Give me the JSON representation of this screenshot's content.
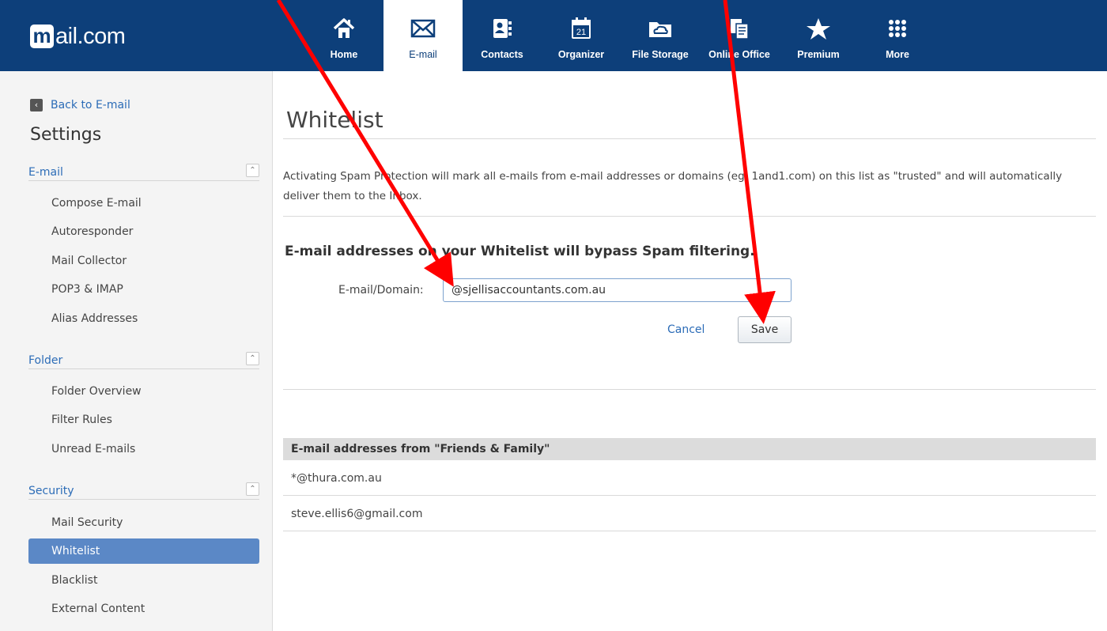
{
  "brand": {
    "logo_letter": "m",
    "logo_text": "ail.com"
  },
  "nav": [
    {
      "label": "Home",
      "icon": "home-icon"
    },
    {
      "label": "E-mail",
      "icon": "envelope-icon",
      "active": true
    },
    {
      "label": "Contacts",
      "icon": "contacts-icon"
    },
    {
      "label": "Organizer",
      "icon": "calendar-icon",
      "day": "21"
    },
    {
      "label": "File Storage",
      "icon": "cloud-folder-icon"
    },
    {
      "label": "Online Office",
      "icon": "documents-icon"
    },
    {
      "label": "Premium",
      "icon": "star-icon"
    },
    {
      "label": "More",
      "icon": "grid-icon"
    }
  ],
  "sidebar": {
    "back_label": "Back to E-mail",
    "title": "Settings",
    "sections": [
      {
        "title": "E-mail",
        "items": [
          "Compose E-mail",
          "Autoresponder",
          "Mail Collector",
          "POP3 & IMAP",
          "Alias Addresses"
        ]
      },
      {
        "title": "Folder",
        "items": [
          "Folder Overview",
          "Filter Rules",
          "Unread E-mails"
        ]
      },
      {
        "title": "Security",
        "items": [
          "Mail Security",
          "Whitelist",
          "Blacklist",
          "External Content"
        ]
      }
    ],
    "active_item": "Whitelist"
  },
  "main": {
    "title": "Whitelist",
    "description": "Activating Spam Protection will mark all e-mails from e-mail addresses or domains (eg: 1and1.com) on this list as \"trusted\" and will automatically deliver them to the Inbox.",
    "subheading": "E-mail addresses on your Whitelist will bypass Spam filtering.",
    "field_label": "E-mail/Domain:",
    "field_value": "@sjellisaccountants.com.au",
    "cancel_label": "Cancel",
    "save_label": "Save",
    "list_header": "E-mail addresses from \"Friends & Family\"",
    "list_items": [
      "*@thura.com.au",
      "steve.ellis6@gmail.com"
    ]
  },
  "colors": {
    "topbar": "#0d3f7a",
    "link": "#2c6cb7",
    "active_item": "#5b88c6",
    "annotation": "#ff0000"
  }
}
